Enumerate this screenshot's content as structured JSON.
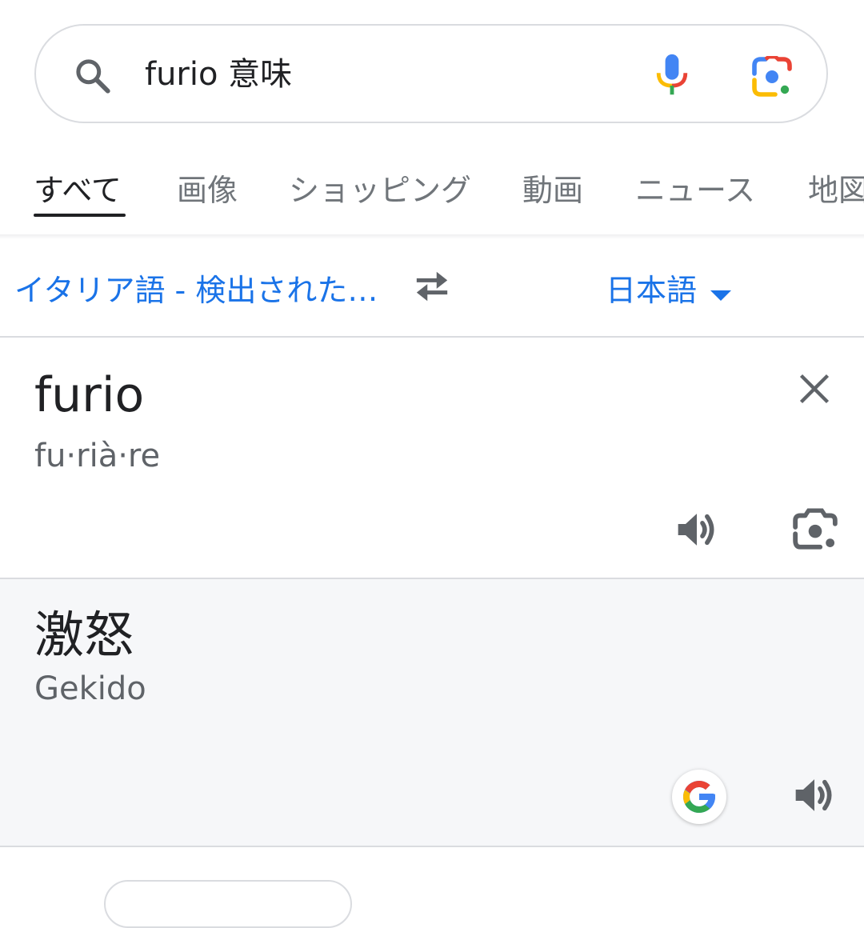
{
  "search": {
    "query": "furio 意味",
    "icons": [
      "search-icon",
      "mic-icon",
      "lens-icon"
    ]
  },
  "tabs": [
    {
      "label": "すべて",
      "active": true
    },
    {
      "label": "画像",
      "active": false
    },
    {
      "label": "ショッピング",
      "active": false
    },
    {
      "label": "動画",
      "active": false
    },
    {
      "label": "ニュース",
      "active": false
    },
    {
      "label": "地図",
      "active": false
    }
  ],
  "translate": {
    "source_language": "イタリア語 - 検出された…",
    "target_language": "日本語",
    "source_text": "furio",
    "source_pronunciation": "fu·rià·re",
    "target_text": "激怒",
    "target_pronunciation": "Gekido"
  },
  "colors": {
    "link_blue": "#1a73e8",
    "panel_background": "#f6f7f9",
    "divider": "#dadce0"
  }
}
